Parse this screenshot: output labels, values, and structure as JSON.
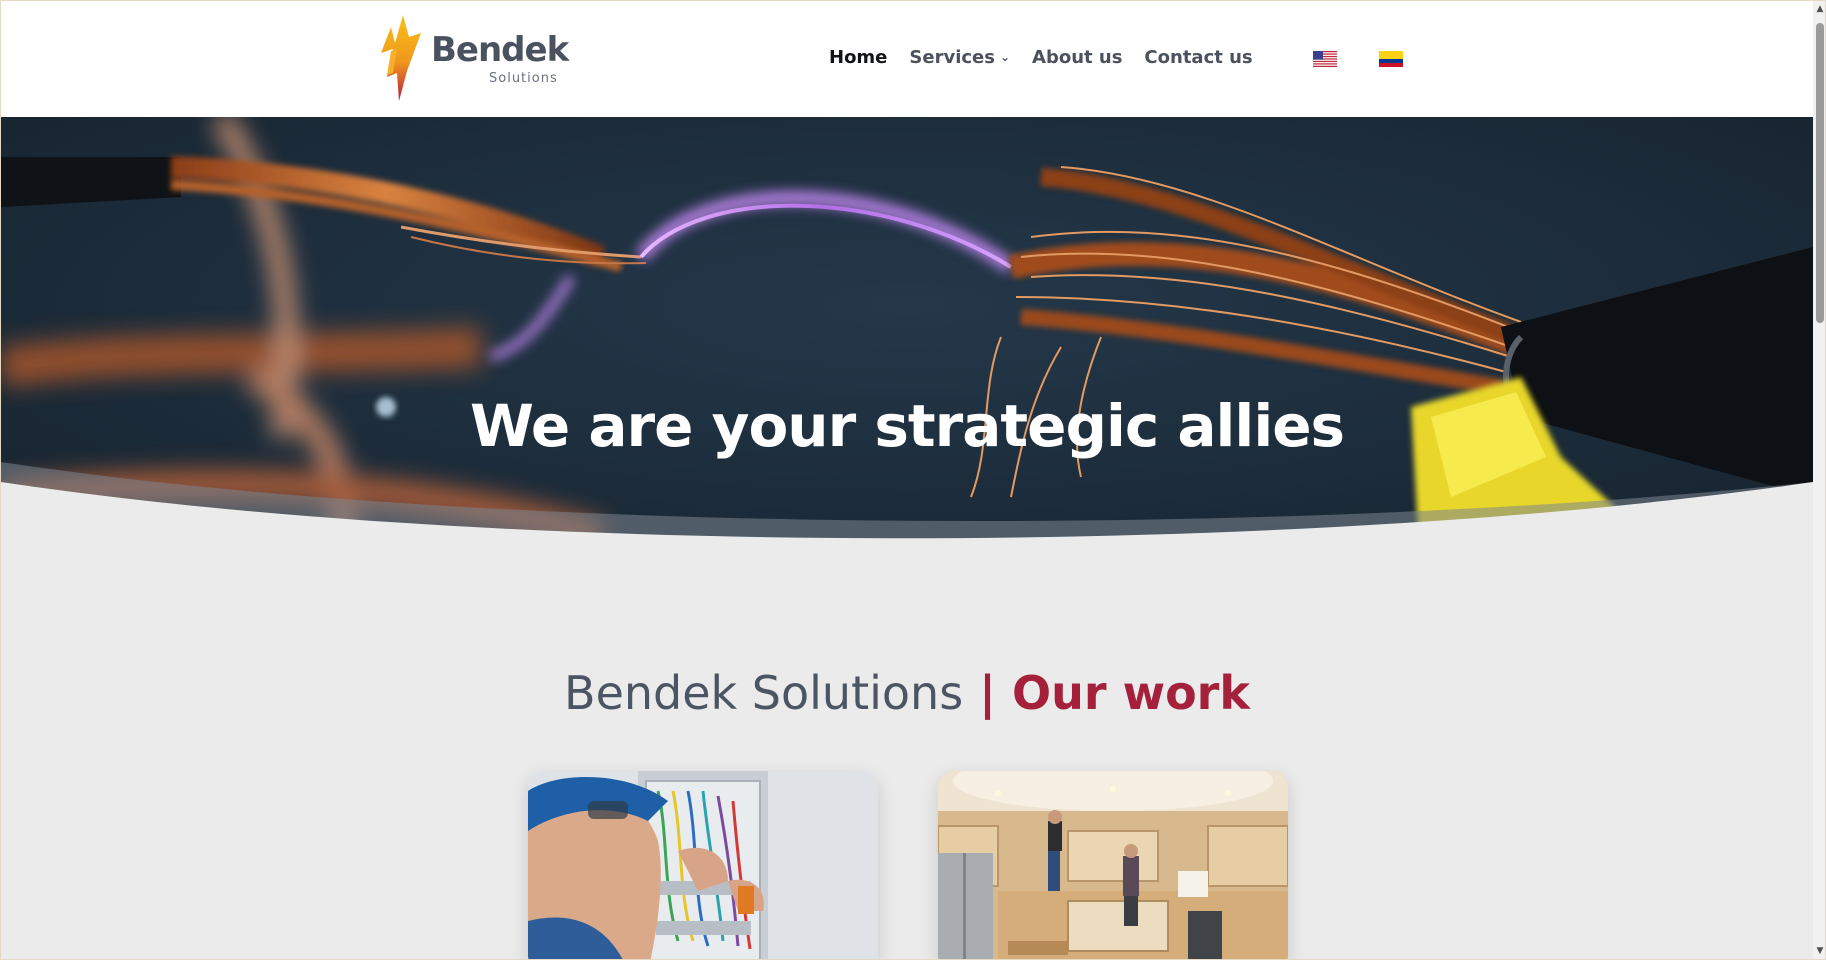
{
  "header": {
    "logo": {
      "name": "Bendek",
      "sub": "Solutions"
    },
    "nav": [
      {
        "label": "Home",
        "active": true
      },
      {
        "label": "Services",
        "has_dropdown": true
      },
      {
        "label": "About us"
      },
      {
        "label": "Contact us"
      }
    ],
    "languages": [
      {
        "icon": "us-flag-icon"
      },
      {
        "icon": "colombia-flag-icon"
      }
    ]
  },
  "hero": {
    "title": "We are your strategic allies"
  },
  "section": {
    "title_main": "Bendek Solutions",
    "title_separator": " | ",
    "title_accent": "Our work"
  },
  "colors": {
    "brand_dark": "#4b5563",
    "brand_accent": "#a5203a",
    "brand_yellow": "#f4b81c",
    "page_bg": "#ebebeb",
    "hero_bg": "#1c2b38"
  }
}
